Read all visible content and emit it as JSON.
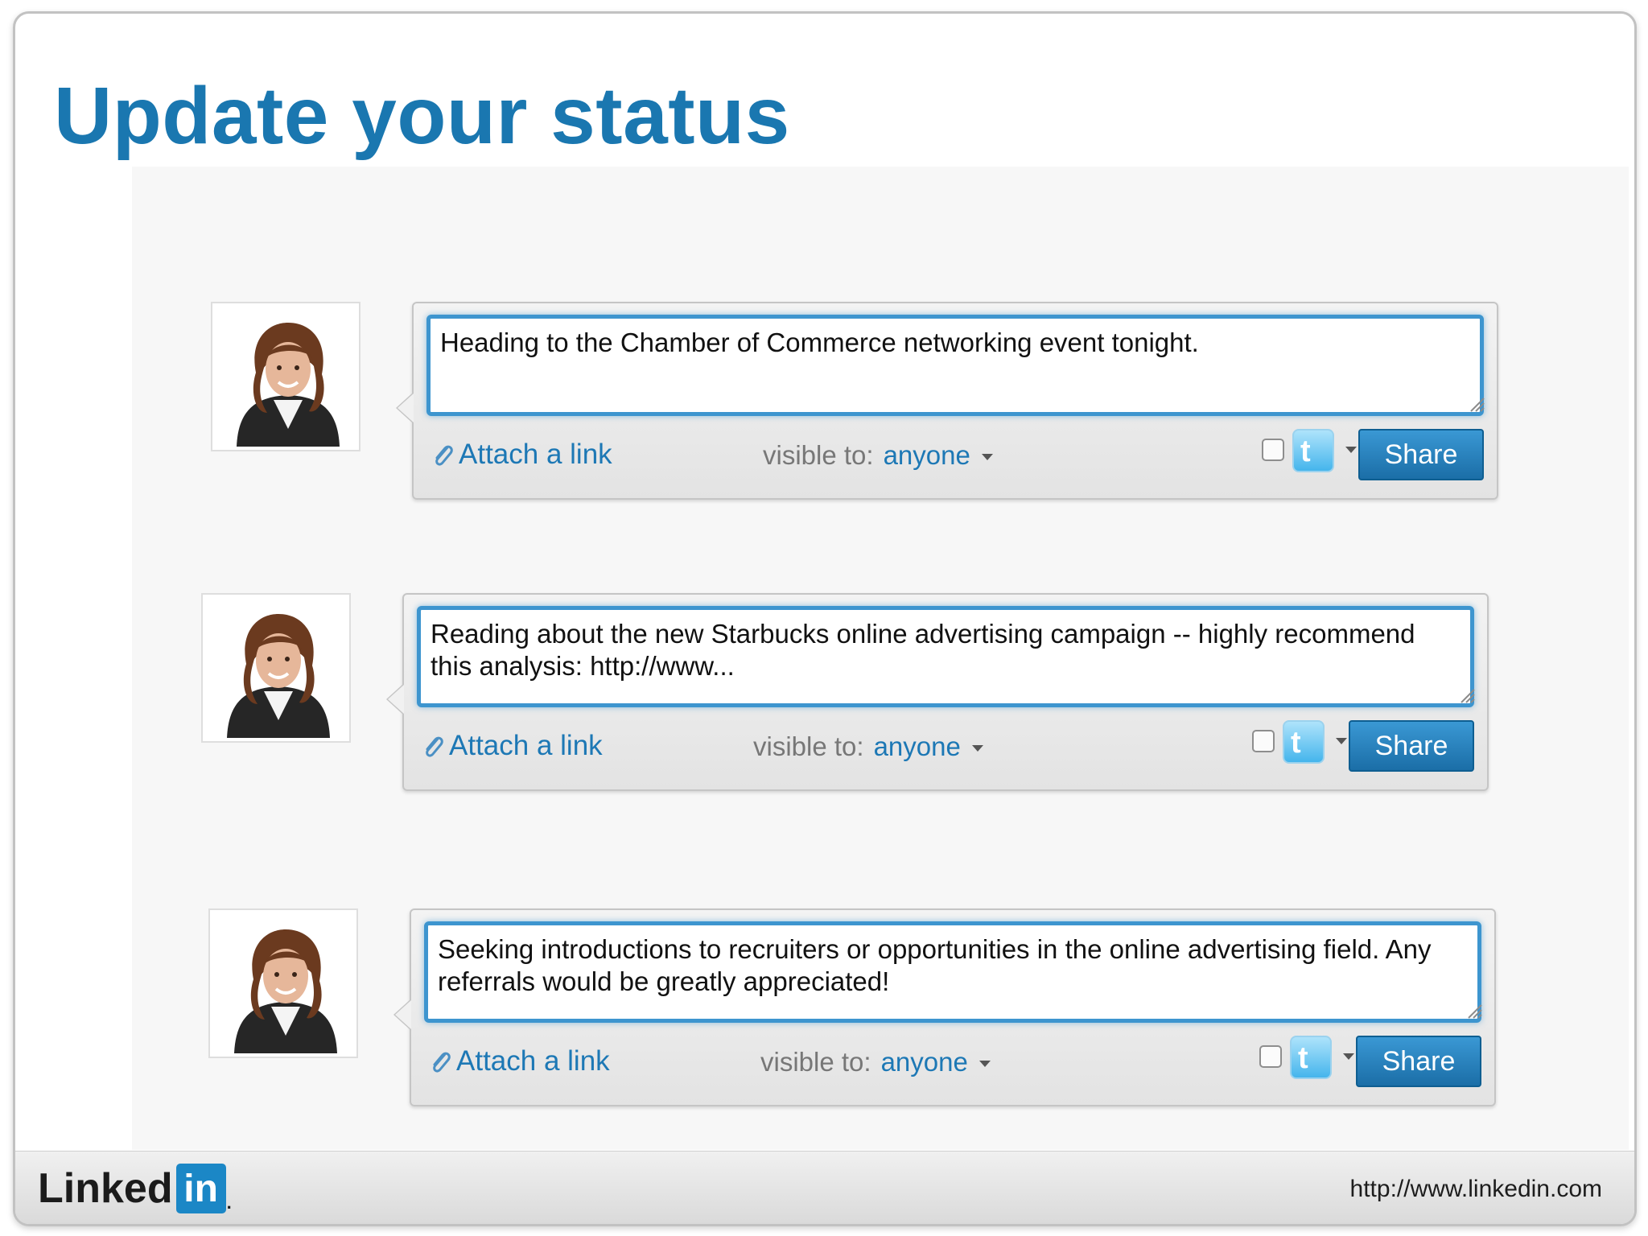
{
  "slide": {
    "title": "Update your status"
  },
  "status_updates": [
    {
      "text": "Heading to the Chamber of Commerce networking event tonight.",
      "attach_label": "Attach a link",
      "visibility_label": "visible to:",
      "visibility_value": "anyone",
      "share_label": "Share",
      "twitter_glyph": "t"
    },
    {
      "text": "Reading about the new Starbucks online advertising campaign -- highly recommend this analysis: http://www...",
      "attach_label": "Attach a link",
      "visibility_label": "visible to:",
      "visibility_value": "anyone",
      "share_label": "Share",
      "twitter_glyph": "t"
    },
    {
      "text": "Seeking introductions to recruiters or opportunities in the online advertising field. Any referrals would be greatly appreciated!",
      "attach_label": "Attach a link",
      "visibility_label": "visible to:",
      "visibility_value": "anyone",
      "share_label": "Share",
      "twitter_glyph": "t"
    }
  ],
  "footer": {
    "brand_word": "Linked",
    "brand_in": "in",
    "brand_dot": ".",
    "url": "http://www.linkedin.com"
  },
  "icons": [
    "paperclip-icon",
    "twitter-icon",
    "chevron-down-icon",
    "resize-grip-icon"
  ],
  "colors": {
    "title": "#1a77b0",
    "link": "#1d78b5",
    "input_border": "#3d95cf",
    "share_button": "#1b6ea7",
    "linkedin_blue": "#1b87c6"
  }
}
